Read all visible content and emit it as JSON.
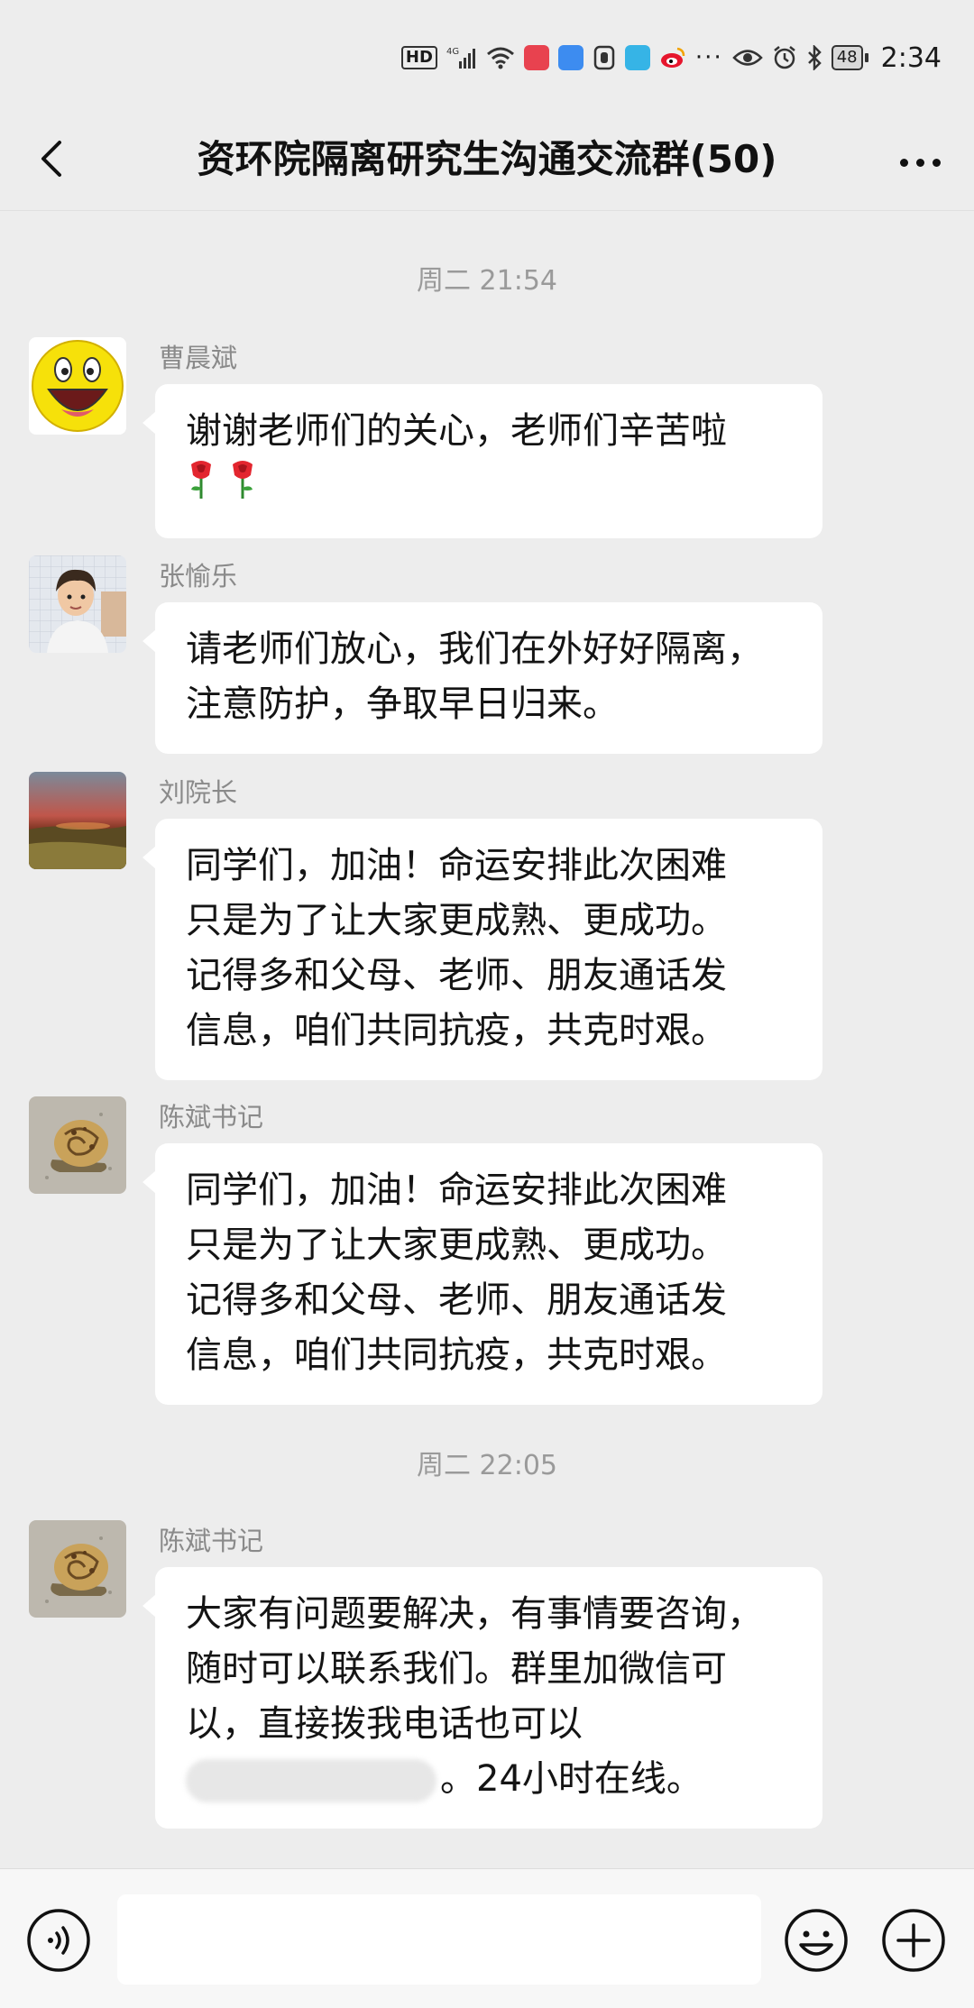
{
  "status_bar": {
    "network_badge": "HD",
    "signal": "4G",
    "battery": "48",
    "time": "2:34",
    "icons": [
      "hd-icon",
      "signal-icon",
      "wifi-icon",
      "app-icon-red",
      "cloud-icon",
      "hand-icon",
      "app-icon-blue",
      "weibo-icon",
      "more-dots-icon",
      "eye-icon",
      "alarm-icon",
      "bluetooth-icon",
      "battery-icon"
    ]
  },
  "header": {
    "title": "资环院隔离研究生沟通交流群(50)"
  },
  "chat": {
    "timestamps": [
      "周二 21:54",
      "周二 22:05"
    ],
    "messages": [
      {
        "sender": "曹晨斌",
        "avatar": "smiley-face",
        "lines": [
          "谢谢老师们的关心，老师们辛苦啦",
          "🌹🌹"
        ]
      },
      {
        "sender": "张愉乐",
        "avatar": "child-photo",
        "lines": [
          "请老师们放心，我们在外好好隔离，",
          "注意防护，争取早日归来。"
        ]
      },
      {
        "sender": "刘院长",
        "avatar": "sunset-landscape",
        "lines": [
          "同学们，加油！命运安排此次困难",
          "只是为了让大家更成熟、更成功。",
          "记得多和父母、老师、朋友通话发",
          "信息，咱们共同抗疫，共克时艰。"
        ]
      },
      {
        "sender": "陈斌书记",
        "avatar": "snail-photo",
        "lines": [
          "同学们，加油！命运安排此次困难",
          "只是为了让大家更成熟、更成功。",
          "记得多和父母、老师、朋友通话发",
          "信息，咱们共同抗疫，共克时艰。"
        ]
      },
      {
        "sender": "陈斌书记",
        "avatar": "snail-photo",
        "lines": [
          "大家有问题要解决，有事情要咨询，",
          "随时可以联系我们。群里加微信可",
          "以，直接拨我电话也可以",
          "。24小时在线。"
        ]
      }
    ]
  },
  "colors": {
    "background": "#ededed",
    "bubble": "#ffffff",
    "sender_name": "#8a8a8a",
    "timestamp": "#9a9a9a"
  }
}
